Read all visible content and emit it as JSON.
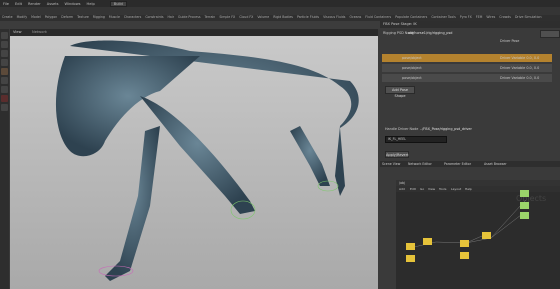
{
  "menu": [
    "File",
    "Edit",
    "Render",
    "Assets",
    "Windows",
    "Help",
    "Build"
  ],
  "shelf_tabs": [
    "Create",
    "Modify",
    "Model",
    "Polygon",
    "Deform",
    "Texture",
    "Rigging",
    "Muscle",
    "Characters",
    "Constraints",
    "Hair",
    "Guide Process",
    "Terrain",
    "Simple FX",
    "Cloud FX",
    "Volume",
    "Rigid Bodies",
    "Particle Fluids",
    "Viscous Fluids",
    "Oceans",
    "Fluid Containers",
    "Populate Containers",
    "Container Tools",
    "Pyro FX",
    "FEM",
    "Wires",
    "Crowds",
    "Drive Simulation"
  ],
  "viewport": {
    "tab": "View",
    "tab2": "Network",
    "corner_label": "Objects"
  },
  "rp": {
    "header_tab": "FBX Pose Stage: IK",
    "path_label": "Rigging PSD Node",
    "path_value": "obj/horse1/rig/rigging_psd",
    "section_label": "Driver Pose",
    "rows": [
      {
        "name": "pose/object",
        "value": "Driver Variable 0.0, 0.0",
        "selected": true
      },
      {
        "name": "pose/object",
        "value": "Driver Variable 0.0, 0.0",
        "selected": false
      },
      {
        "name": "pose/object",
        "value": "Driver Variable 0.0, 0.0",
        "selected": false
      }
    ],
    "add_button": "Add Pose Shape",
    "param_label": "Handle Driver Node",
    "param_value": "../FBX_Pose/rigging_psd_driver",
    "expr_value": "IK_FL_HEEL",
    "dropdown": "Apply/Revert",
    "net_tabs": [
      "Scene View",
      "Network Editor",
      "Parameter Editor",
      "Asset Browser"
    ],
    "net_path": "/obj",
    "net_menu": [
      "Add",
      "Edit",
      "Go",
      "View",
      "Tools",
      "Layout",
      "Help"
    ],
    "net_watermark": "Objects"
  }
}
